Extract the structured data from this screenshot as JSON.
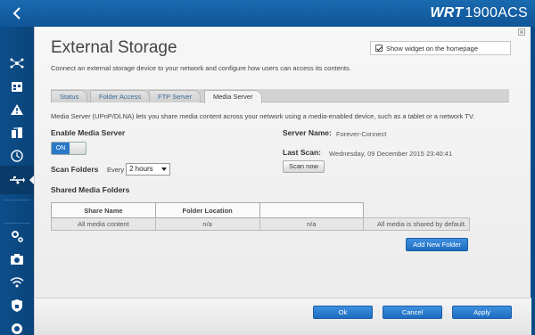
{
  "brand": {
    "prefix": "WRT",
    "model": "1900ACS"
  },
  "page": {
    "title": "External Storage",
    "subtitle": "Connect an external storage device to your network and configure how users can access its contents.",
    "widget_label": "Show widget on the homepage",
    "widget_checked": true
  },
  "tabs": [
    {
      "label": "Status"
    },
    {
      "label": "Folder Access"
    },
    {
      "label": "FTP Server"
    },
    {
      "label": "Media Server"
    }
  ],
  "media": {
    "description": "Media Server (UPnP/DLNA) lets you share media content across your network using a media-enabled device, such as a tablet or a network TV.",
    "enable_label": "Enable Media Server",
    "toggle_label": "ON",
    "scan_folders_label": "Scan Folders",
    "every_label": "Every",
    "scan_interval": "2 hours",
    "server_name_label": "Server Name:",
    "server_name": "Forever-Connect",
    "last_scan_label": "Last Scan:",
    "last_scan": "Wednesday, 09 December 2015 23:40:41",
    "scan_now": "Scan now"
  },
  "shared": {
    "heading": "Shared Media Folders",
    "columns": [
      "Share Name",
      "Folder Location",
      "",
      ""
    ],
    "rows": [
      [
        "All media content",
        "n/a",
        "n/a",
        "All media is shared by default."
      ]
    ],
    "add_button": "Add New Folder"
  },
  "footer": {
    "ok": "Ok",
    "cancel": "Cancel",
    "apply": "Apply"
  },
  "colors": {
    "accent": "#1e6cc0",
    "sidebar": "#0b4a85"
  },
  "sidebar_icons": [
    "network-map-icon",
    "device-list-icon",
    "alert-icon",
    "parental-icon",
    "clock-icon",
    "usb-storage-icon",
    "settings-icon",
    "camera-icon",
    "wifi-icon",
    "security-icon",
    "troubleshoot-icon"
  ]
}
